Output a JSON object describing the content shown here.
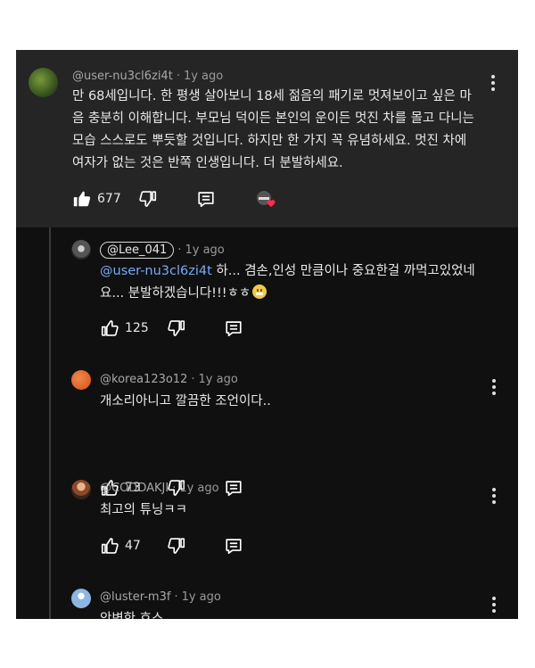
{
  "comments": [
    {
      "handle": "@user-nu3cl6zi4t",
      "time": "1y ago",
      "lines": [
        "만 68세입니다. 한 평생 살아보니 18세 젊음의 패기로 멋져보이고 싶은 마",
        "음 충분히 이해합니다. 부모님 덕이든 본인의 운이든 멋진 차를 몰고 다니는",
        "모습 스스로도 뿌듯할 것입니다. 하지만 한 가지 꼭 유념하세요. 멋진 차에",
        "여자가 없는 것은 반쪽 인생입니다. 더 분발하세요."
      ],
      "likes": "677",
      "avatar_color": "#4a6b2a",
      "icons": [
        "like-icon",
        "dislike-icon",
        "reply-icon",
        "creator-heart-icon",
        "more-options-icon"
      ]
    },
    {
      "handle": "@Lee_041",
      "time": "1y ago",
      "mention": "@user-nu3cl6zi4t",
      "line1_rest": " 하... 겸손,인성 만큼이나 중요한걸 까먹고있었네",
      "line2": "요... 분발하겠습니다!!!ㅎㅎ",
      "likes": "125",
      "avatar_color": "#5a5a5a",
      "icons": [
        "like-icon",
        "dislike-icon",
        "reply-icon",
        "grinning-emoji-icon"
      ]
    },
    {
      "handle": "@korea123o12",
      "time": "1y ago",
      "text": "개소리아니고 깔끔한 조언이다..",
      "likes": "73",
      "avatar_color": "#e0622a",
      "icons": [
        "like-icon",
        "dislike-icon",
        "reply-icon",
        "more-options-icon"
      ]
    },
    {
      "handle": "@CODDAKJI",
      "time": "1y ago",
      "text": "최고의 튜닝ㅋㅋ",
      "likes": "47",
      "avatar_color": "#8a5a3a",
      "icons": [
        "like-icon",
        "dislike-icon",
        "reply-icon",
        "more-options-icon"
      ]
    },
    {
      "handle": "@luster-m3f",
      "time": "1y ago",
      "text": "안변한 흐스",
      "avatar_color": "#7fa8d8",
      "icons": [
        "more-options-icon"
      ]
    }
  ],
  "colors": {
    "background": "#101010",
    "top_comment_background": "#252525",
    "mention": "#7aaaf4",
    "text": "#e8e8e8",
    "meta": "#9a9a9a"
  }
}
